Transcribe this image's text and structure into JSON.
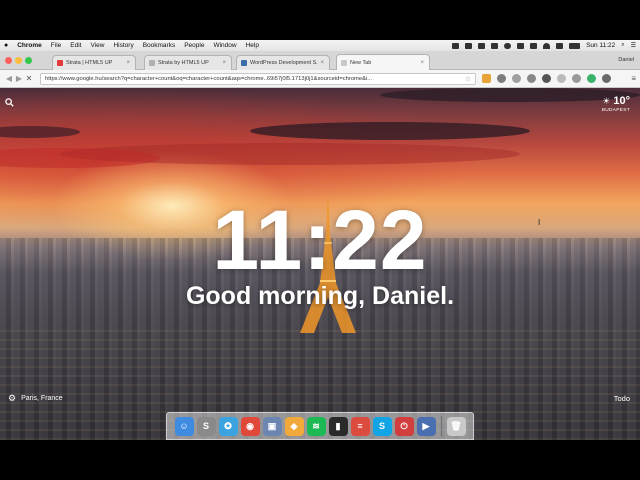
{
  "menubar": {
    "app_name": "Chrome",
    "menus": [
      "File",
      "Edit",
      "View",
      "History",
      "Bookmarks",
      "People",
      "Window",
      "Help"
    ],
    "clock": "Sun 11:22"
  },
  "tabs": [
    {
      "title": "Strata | HTML5 UP",
      "favicon_color": "#e33b3b",
      "active": false
    },
    {
      "title": "Strata by HTML5 UP",
      "favicon_color": "#b0b0b0",
      "active": false
    },
    {
      "title": "WordPress Development S...",
      "favicon_color": "#3b6ea8",
      "active": false
    },
    {
      "title": "New Tab",
      "favicon_color": "#c8c8c8",
      "active": true
    }
  ],
  "profile_name": "Daniel",
  "omnibox": {
    "url": "https://www.google.hu/search?q=character+count&oq=character+count&aqs=chrome..69i57j0l5.1713j0j1&sourceid=chrome&i..."
  },
  "page": {
    "time": "11:22",
    "greeting": "Good morning, Daniel.",
    "weather": {
      "temp": "10°",
      "location": "BUDAPEST"
    },
    "photo_location": "Paris, France",
    "todo_label": "Todo"
  },
  "dock": {
    "apps": [
      {
        "name": "finder",
        "color": "#3e8be0",
        "glyph": "☺"
      },
      {
        "name": "scrivener",
        "color": "#8a8a8a",
        "glyph": "S"
      },
      {
        "name": "safari",
        "color": "#3aa3e0",
        "glyph": "✪"
      },
      {
        "name": "chrome",
        "color": "#e0483a",
        "glyph": "◉"
      },
      {
        "name": "preview",
        "color": "#6b86b0",
        "glyph": "▣"
      },
      {
        "name": "sketch",
        "color": "#f2a93b",
        "glyph": "◆"
      },
      {
        "name": "spotify",
        "color": "#1db954",
        "glyph": "≋"
      },
      {
        "name": "terminal",
        "color": "#2a2a2a",
        "glyph": "▮"
      },
      {
        "name": "todoist",
        "color": "#db4c3f",
        "glyph": "≡"
      },
      {
        "name": "skype",
        "color": "#12a5e5",
        "glyph": "S"
      },
      {
        "name": "toggl",
        "color": "#d23d3d",
        "glyph": "⏻"
      },
      {
        "name": "screenflow",
        "color": "#4a6fb0",
        "glyph": "▶"
      },
      {
        "name": "trash",
        "color": "#c9c9c9",
        "glyph": "🗑"
      }
    ]
  }
}
